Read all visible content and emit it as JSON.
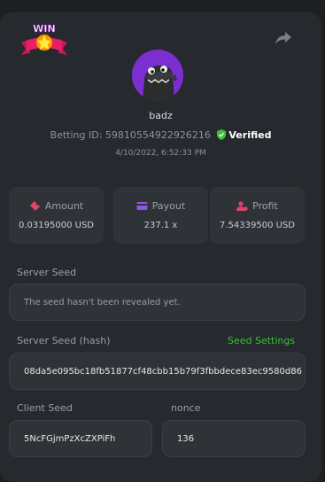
{
  "user": {
    "username": "badz",
    "betting_id_label": "Betting ID:",
    "betting_id": "59810554922926216",
    "verified_label": "Verified",
    "date": "4/10/2022, 6:52:33 PM"
  },
  "badge": {
    "text": "WIN"
  },
  "stats": [
    {
      "label": "Amount",
      "value": "0.03195000 USD"
    },
    {
      "label": "Payout",
      "value": "237.1 x"
    },
    {
      "label": "Profit",
      "value": "7.54339500 USD"
    }
  ],
  "server_seed": {
    "label": "Server Seed",
    "value": "The seed hasn't been revealed yet."
  },
  "server_seed_hash": {
    "label": "Server Seed (hash)",
    "settings_link": "Seed Settings",
    "value": "08da5e095bc18fb51877cf48cbb15b79f3fbbdece83ec9580d86"
  },
  "client_seed": {
    "label": "Client Seed",
    "value": "5NcFGjmPzXcZXPiFh"
  },
  "nonce": {
    "label": "nonce",
    "value": "136"
  },
  "colors": {
    "accent_green": "#3fbf3a",
    "amount_icon": "#e0436b",
    "payout_icon": "#8a55e8",
    "profit_icon": "#e0436b",
    "avatar_bg": "#7b2fd0"
  },
  "icons": {
    "badge": "win-badge-icon",
    "share": "share-icon",
    "verified": "shield-check-icon",
    "amount": "bet-ticket-icon",
    "payout": "card-icon",
    "profit": "user-money-icon"
  }
}
